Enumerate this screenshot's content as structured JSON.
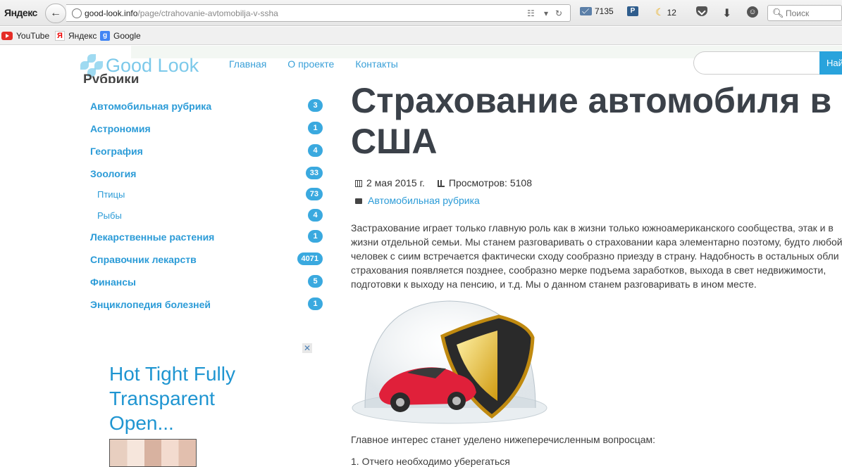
{
  "browser": {
    "brand": "Яндекс",
    "url_host": "good-look.info",
    "url_path": "/page/ctrahovanie-avtomobilja-v-ssha",
    "mail_count": "7135",
    "weather_value": "12",
    "search_placeholder": "Поиск",
    "bookmarks": [
      "YouTube",
      "Яндекс",
      "Google"
    ]
  },
  "site": {
    "logo_text": "Good Look",
    "nav": [
      "Главная",
      "О проекте",
      "Контакты"
    ],
    "search_button": "Най"
  },
  "sidebar": {
    "title": "Рубрики",
    "categories": [
      {
        "label": "Автомобильная рубрика",
        "count": "3",
        "sub": false
      },
      {
        "label": "Астрономия",
        "count": "1",
        "sub": false
      },
      {
        "label": "География",
        "count": "4",
        "sub": false
      },
      {
        "label": "Зоология",
        "count": "33",
        "sub": false
      },
      {
        "label": "Птицы",
        "count": "73",
        "sub": true
      },
      {
        "label": "Рыбы",
        "count": "4",
        "sub": true
      },
      {
        "label": "Лекарственные растения",
        "count": "1",
        "sub": false
      },
      {
        "label": "Справочник лекарств",
        "count": "4071",
        "sub": false
      },
      {
        "label": "Финансы",
        "count": "5",
        "sub": false
      },
      {
        "label": "Энциклопедия болезней",
        "count": "1",
        "sub": false
      }
    ]
  },
  "ad": {
    "close": "✕",
    "title": "Hot Tight Fully Transparent Open..."
  },
  "article": {
    "title_line1": "Страхование автомобиля в",
    "title_line2": "США",
    "date": "2 мая 2015 г.",
    "views": "Просмотров: 5108",
    "category": "Автомобильная рубрика",
    "paragraph_lines": [
      "Застрахование играет только главную роль как в жизни только южноамериканского сообщества, этак и в",
      "жизни отдельной семьи. Мы станем разговаривать о страховании кара элементарно поэтому, будто любой",
      "человек с сиим встречается фактически сходу сообразно приезду в страну. Надобность в остальных обли",
      "страхования появляется позднее, сообразно мерке подъема заработков, выхода в свет недвижимости,",
      "подготовки к выходу на пенсию, и т.д. Мы о данном станем разговаривать в ином месте."
    ],
    "paragraph2": "Главное интерес станет уделено нижеперечисленным вопросцам:",
    "list_item1": "1. Отчего необходимо уберегаться"
  }
}
